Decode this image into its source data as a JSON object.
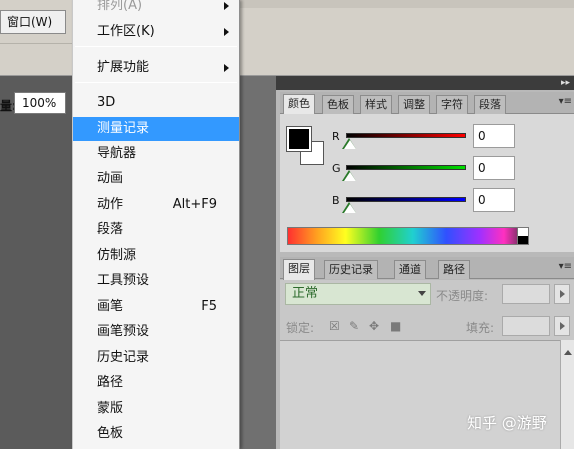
{
  "app": {
    "window_menu_label": "窗口(W)",
    "zoom_label": "量:",
    "zoom_value": "100%"
  },
  "dropdown": {
    "items": [
      {
        "label": "排列(A)",
        "submenu": true
      },
      {
        "label": "工作区(K)",
        "submenu": true
      },
      {
        "label": "扩展功能",
        "submenu": true
      },
      {
        "label": "3D"
      },
      {
        "label": "测量记录",
        "highlighted": true
      },
      {
        "label": "导航器"
      },
      {
        "label": "动画"
      },
      {
        "label": "动作",
        "shortcut": "Alt+F9"
      },
      {
        "label": "段落"
      },
      {
        "label": "仿制源"
      },
      {
        "label": "工具预设"
      },
      {
        "label": "画笔",
        "shortcut": "F5"
      },
      {
        "label": "画笔预设"
      },
      {
        "label": "历史记录"
      },
      {
        "label": "路径"
      },
      {
        "label": "蒙版"
      },
      {
        "label": "色板"
      }
    ]
  },
  "color_panel": {
    "tabs": [
      "颜色",
      "色板",
      "样式",
      "调整",
      "字符",
      "段落"
    ],
    "active_tab": "颜色",
    "channels": [
      {
        "label": "R",
        "value": "0"
      },
      {
        "label": "G",
        "value": "0"
      },
      {
        "label": "B",
        "value": "0"
      }
    ],
    "foreground_color": "#000000",
    "background_color": "#ffffff"
  },
  "layers_panel": {
    "tabs": [
      "图层",
      "历史记录",
      "通道",
      "路径"
    ],
    "active_tab": "图层",
    "blend_mode": "正常",
    "opacity_label": "不透明度:",
    "lock_label": "锁定:",
    "fill_label": "填充:"
  },
  "watermark": "知乎 @游野",
  "colors": {
    "menu_highlight": "#3399ff",
    "panel_bg": "#b9b9b9",
    "workspace_bg": "#5b5b5b"
  }
}
